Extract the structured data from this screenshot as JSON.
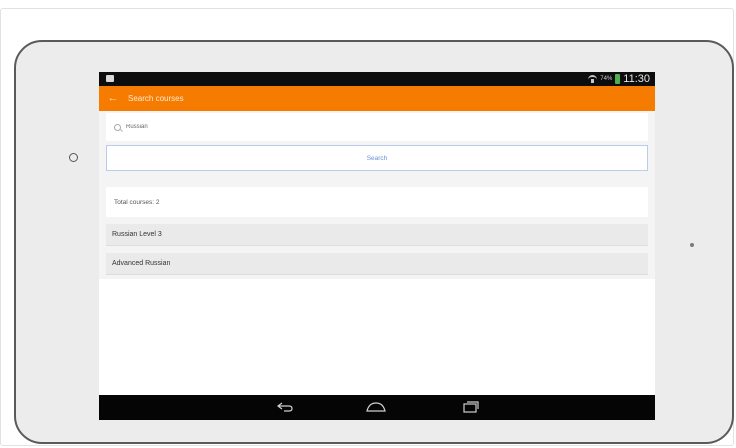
{
  "status_bar": {
    "battery_percent": "74%",
    "time": "11:30"
  },
  "action_bar": {
    "title": "Search courses"
  },
  "search": {
    "query": "Russian",
    "button_label": "Search"
  },
  "results": {
    "total_label": "Total courses: 2",
    "courses": [
      {
        "name": "Russian Level 3"
      },
      {
        "name": "Advanced Russian"
      }
    ]
  },
  "colors": {
    "accent": "#f57c00",
    "search_button_text": "#6b8fd4"
  },
  "icons": {
    "back": "arrow-left-icon",
    "search": "search-icon",
    "nav_back": "nav-back-icon",
    "nav_home": "nav-home-icon",
    "nav_recents": "nav-recents-icon"
  }
}
